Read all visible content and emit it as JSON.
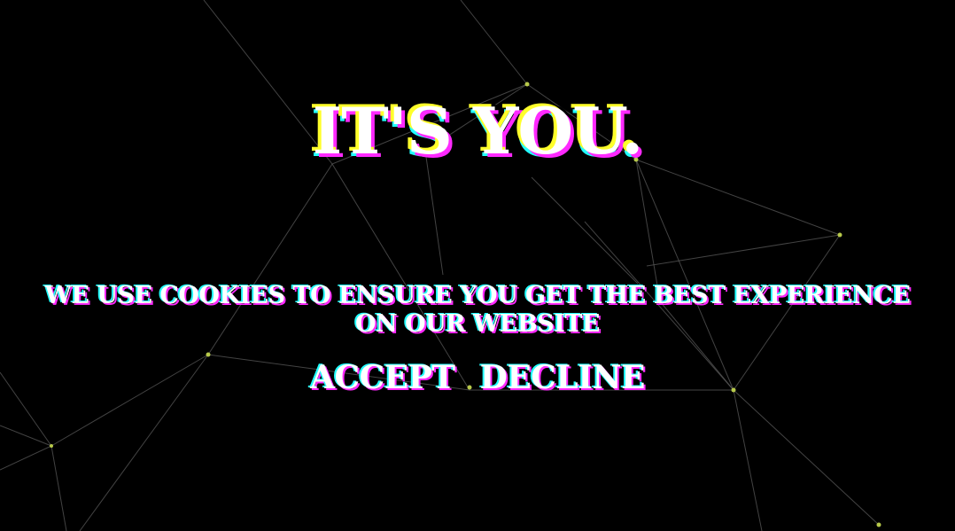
{
  "background_color": "#000000",
  "node_color": "#b7c94a",
  "line_color": "#5a5a5a",
  "glitch_colors": [
    "#ffff2a",
    "#ff29ff",
    "#22ffff"
  ],
  "headline": "IT'S YOU.",
  "message": {
    "line1": "WE USE COOKIES TO ENSURE YOU GET THE BEST EXPERIENCE",
    "line2": "ON OUR WEBSITE"
  },
  "actions": {
    "accept_label": "ACCEPT",
    "decline_label": "DECLINE"
  }
}
